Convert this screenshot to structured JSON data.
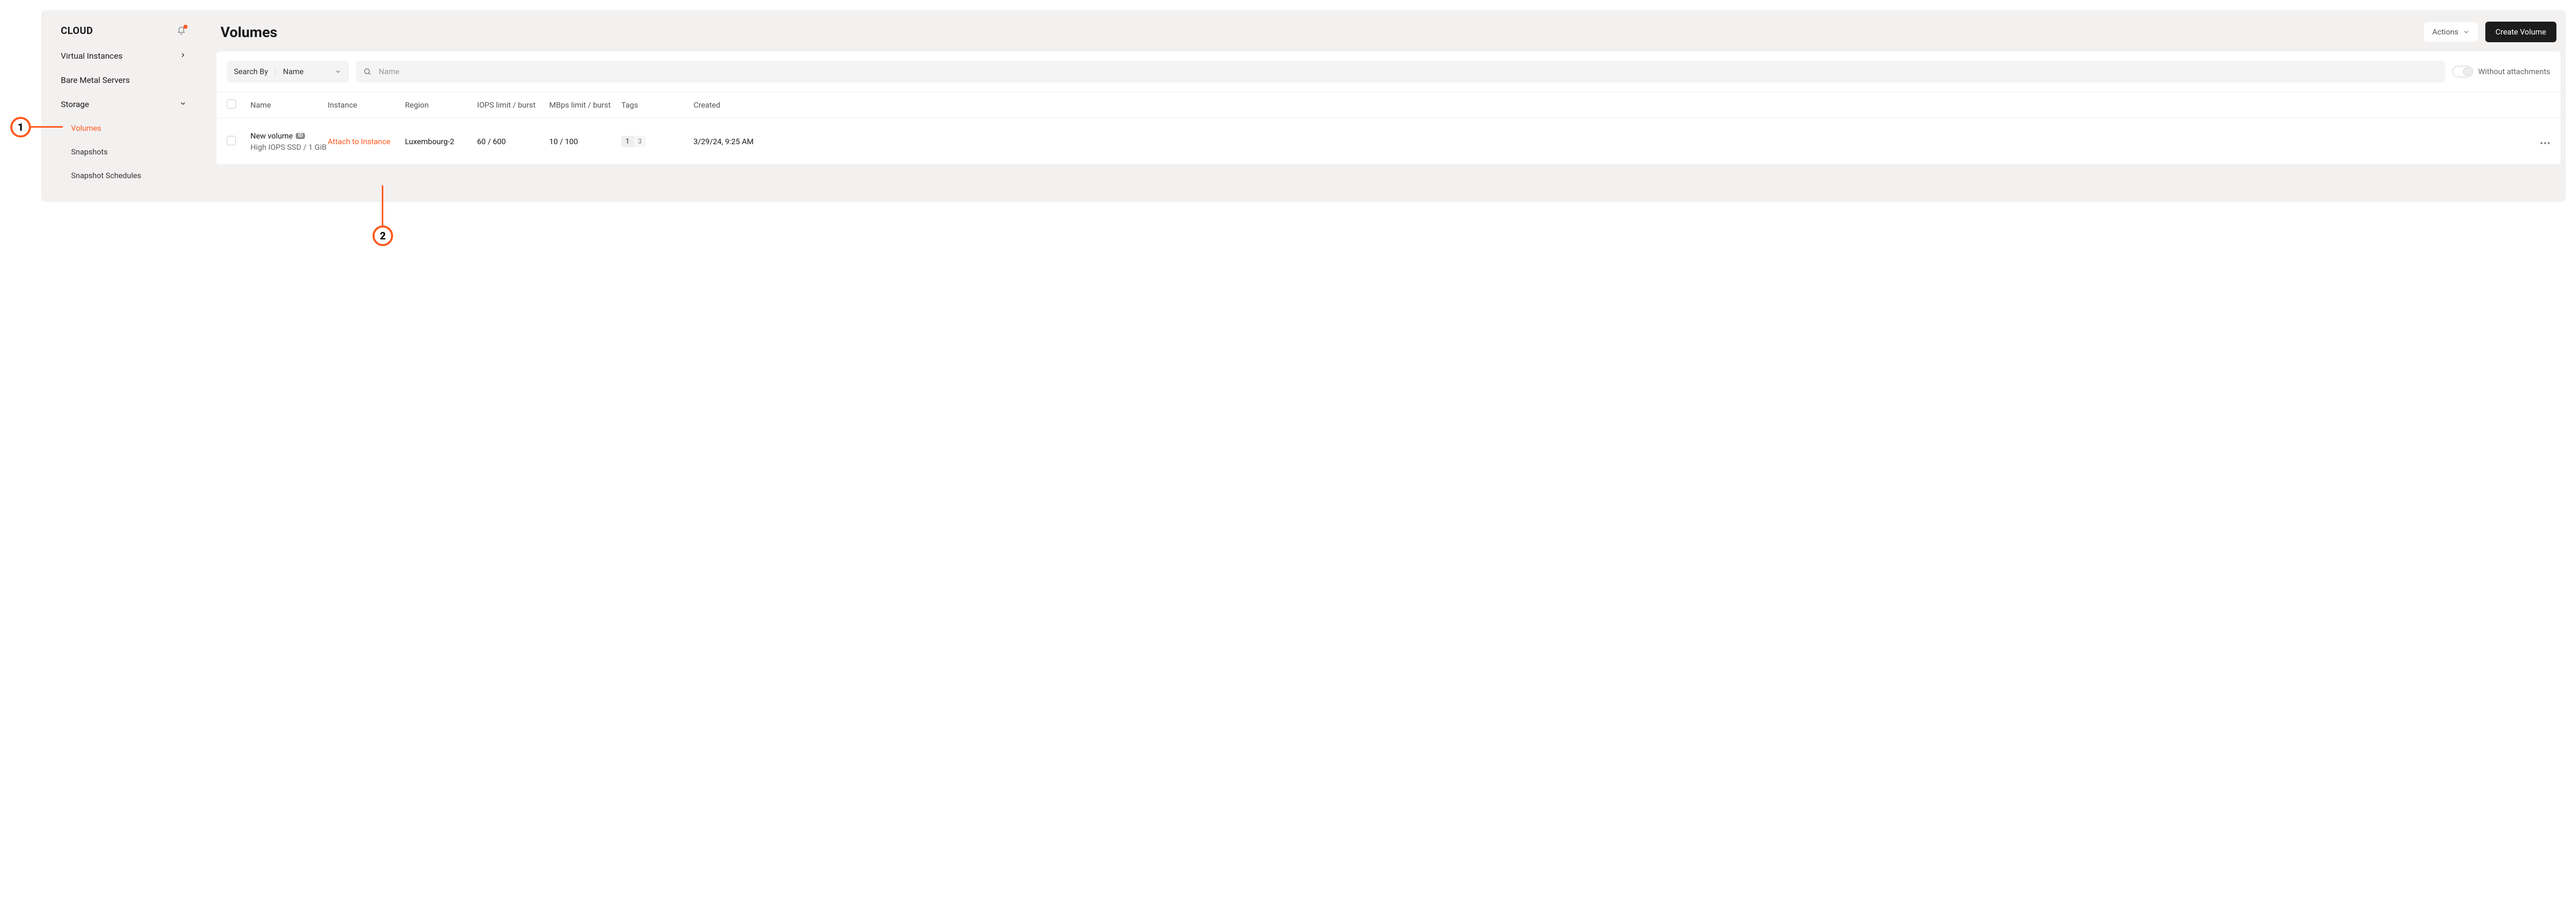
{
  "sidebar": {
    "brand": "CLOUD",
    "items": [
      {
        "label": "Virtual Instances",
        "chevron": "right"
      },
      {
        "label": "Bare Metal Servers"
      },
      {
        "label": "Storage",
        "chevron": "down"
      }
    ],
    "storage_sub": [
      {
        "label": "Volumes",
        "active": true
      },
      {
        "label": "Snapshots"
      },
      {
        "label": "Snapshot Schedules"
      }
    ]
  },
  "header": {
    "title": "Volumes",
    "actions_label": "Actions",
    "create_label": "Create Volume"
  },
  "filters": {
    "search_by_label": "Search By",
    "search_by_value": "Name",
    "search_placeholder": "Name",
    "without_attachments_label": "Without attachments"
  },
  "table": {
    "columns": {
      "name": "Name",
      "instance": "Instance",
      "region": "Region",
      "iops": "IOPS limit / burst",
      "mbps": "MBps limit / burst",
      "tags": "Tags",
      "created": "Created"
    },
    "rows": [
      {
        "name": "New volume",
        "id_badge": "ID",
        "sub": "High IOPS SSD / 1 GiB",
        "instance_action": "Attach to Instance",
        "region": "Luxembourg-2",
        "iops": "60 / 600",
        "mbps": "10 / 100",
        "tags": [
          {
            "k": "1",
            "v": "3"
          }
        ],
        "created": "3/29/24, 9:25 AM"
      }
    ]
  },
  "callouts": {
    "c1": "1",
    "c2": "2"
  },
  "colors": {
    "accent": "#ff5a1f"
  }
}
